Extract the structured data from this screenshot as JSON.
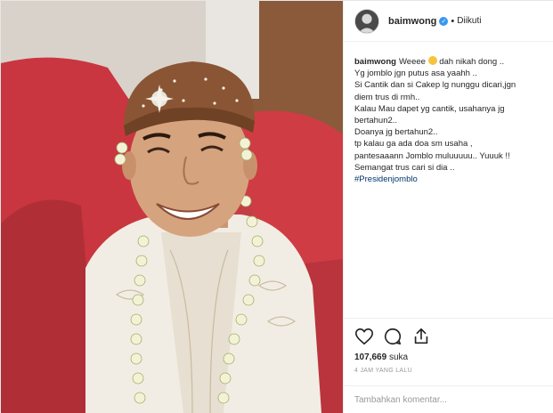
{
  "post": {
    "photo_subject": "groom-photo",
    "username": "baimwong",
    "verified": true,
    "follow_status": "Diikuti",
    "caption": {
      "user": "baimwong",
      "lines": [
        "Weeee",
        "dah nikah dong ..",
        "Yg jomblo jgn putus asa yaahh ..",
        "Si Cantik dan si Cakep lg nunggu dicari,jgn",
        "diem trus di rmh..",
        "Kalau Mau dapet yg cantik, usahanya jg",
        "bertahun2..",
        "Doanya jg bertahun2..",
        "tp kalau ga ada doa sm usaha ,",
        "pantesaaann Jomblo muluuuuu.. Yuuuk !!",
        "Semangat trus cari si dia ..",
        "#Presidenjomblo"
      ]
    },
    "likes_count": "107,669",
    "likes_suffix": "suka",
    "time_ago": "4 JAM YANG LALU",
    "comment_placeholder": "Tambahkan komentar..."
  },
  "icons": {
    "like": "heart-icon",
    "comment": "comment-bubble-icon",
    "share": "share-icon",
    "verified": "verified-badge-icon"
  },
  "colors": {
    "verified": "#3897f0",
    "hashtag": "#003569",
    "muted": "#999999",
    "background_red": "#b23a3f"
  }
}
